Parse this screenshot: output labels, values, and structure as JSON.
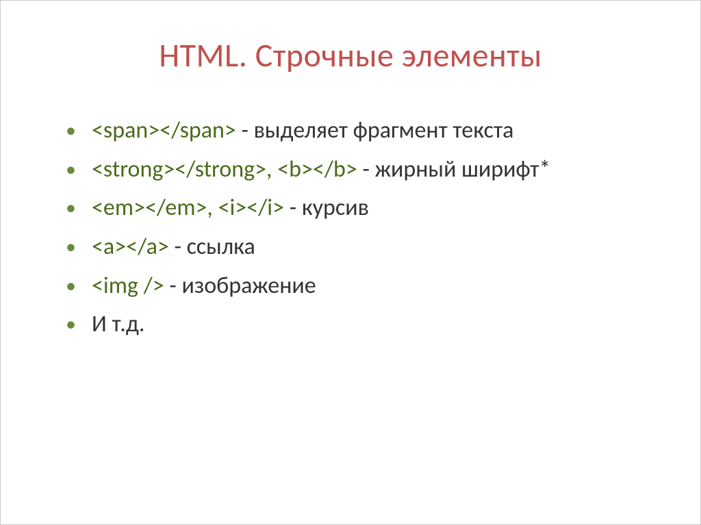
{
  "title": "HTML. Строчные элементы",
  "items": [
    {
      "code": "<span></span>",
      "desc": " - выделяет фрагмент текста"
    },
    {
      "code": "<strong></strong>, <b></b>",
      "desc": " - жирный ширифт*"
    },
    {
      "code": "<em></em>, <i></i>",
      "desc": " - курсив"
    },
    {
      "code": "<a></a>",
      "desc": " - ссылка"
    },
    {
      "code": "<img />",
      "desc": " - изображение"
    },
    {
      "code": "",
      "desc": "И т.д."
    }
  ]
}
